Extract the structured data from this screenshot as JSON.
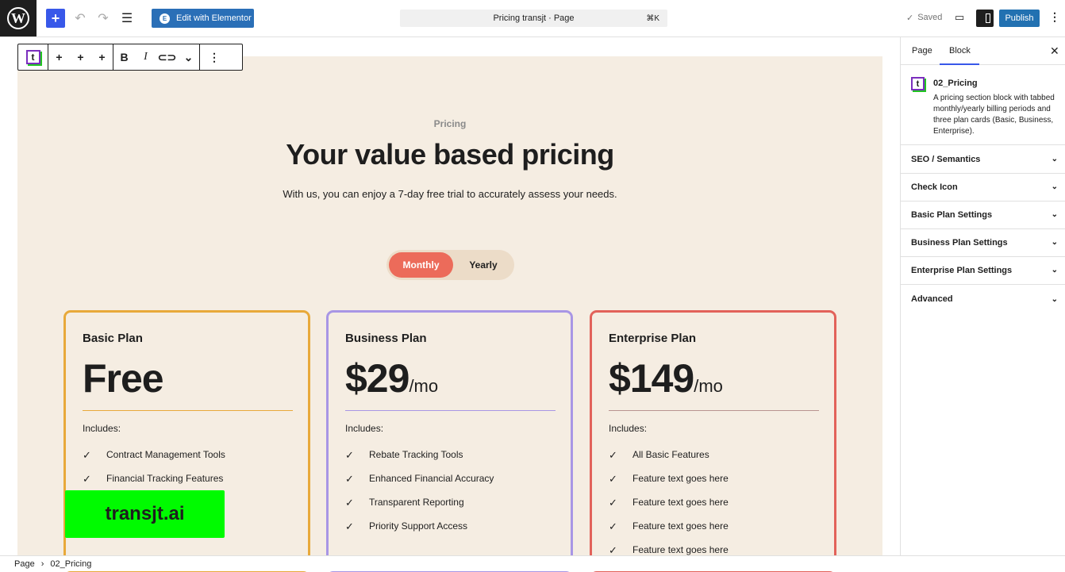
{
  "topbar": {
    "document_title": "Pricing transjt · Page",
    "command_shortcut": "⌘K",
    "elementor_label": "Edit with Elementor",
    "saved_label": "Saved",
    "publish_label": "Publish"
  },
  "block_toolbar": {
    "bold": "B",
    "italic": "I"
  },
  "pricing": {
    "eyebrow": "Pricing",
    "headline": "Your value based pricing",
    "subline": "With us, you can enjoy a 7-day free trial to accurately assess your needs.",
    "toggle": {
      "monthly": "Monthly",
      "yearly": "Yearly"
    },
    "plans": [
      {
        "name": "Basic Plan",
        "price": "Free",
        "per": "",
        "includes": "Includes:",
        "features": [
          "Contract Management Tools",
          "Financial Tracking Features"
        ]
      },
      {
        "name": "Business Plan",
        "price": "$29",
        "per": "/mo",
        "includes": "Includes:",
        "features": [
          "Rebate Tracking Tools",
          "Enhanced Financial Accuracy",
          "Transparent Reporting",
          "Priority Support Access"
        ]
      },
      {
        "name": "Enterprise Plan",
        "price": "$149",
        "per": "/mo",
        "includes": "Includes:",
        "features": [
          "All Basic Features",
          "Feature text goes here",
          "Feature text goes here",
          "Feature text goes here",
          "Feature text goes here"
        ]
      }
    ],
    "watermark": "transjt.ai"
  },
  "sidebar": {
    "tab_page": "Page",
    "tab_block": "Block",
    "block_title": "02_Pricing",
    "block_description": "A pricing section block with tabbed monthly/yearly billing periods and three plan cards (Basic, Business, Enterprise).",
    "panels": [
      "SEO / Semantics",
      "Check Icon",
      "Basic Plan Settings",
      "Business Plan Settings",
      "Enterprise Plan Settings",
      "Advanced"
    ]
  },
  "breadcrumb": {
    "root": "Page",
    "current": "02_Pricing"
  },
  "colors": {
    "section_bg": "#f5ede2",
    "monthly_active": "#ec6b5a",
    "basic_border": "#e8a93a",
    "business_border": "#a896e5",
    "enterprise_border": "#e2625a",
    "publish": "#2271b1",
    "elementor": "#2a6fb7"
  }
}
